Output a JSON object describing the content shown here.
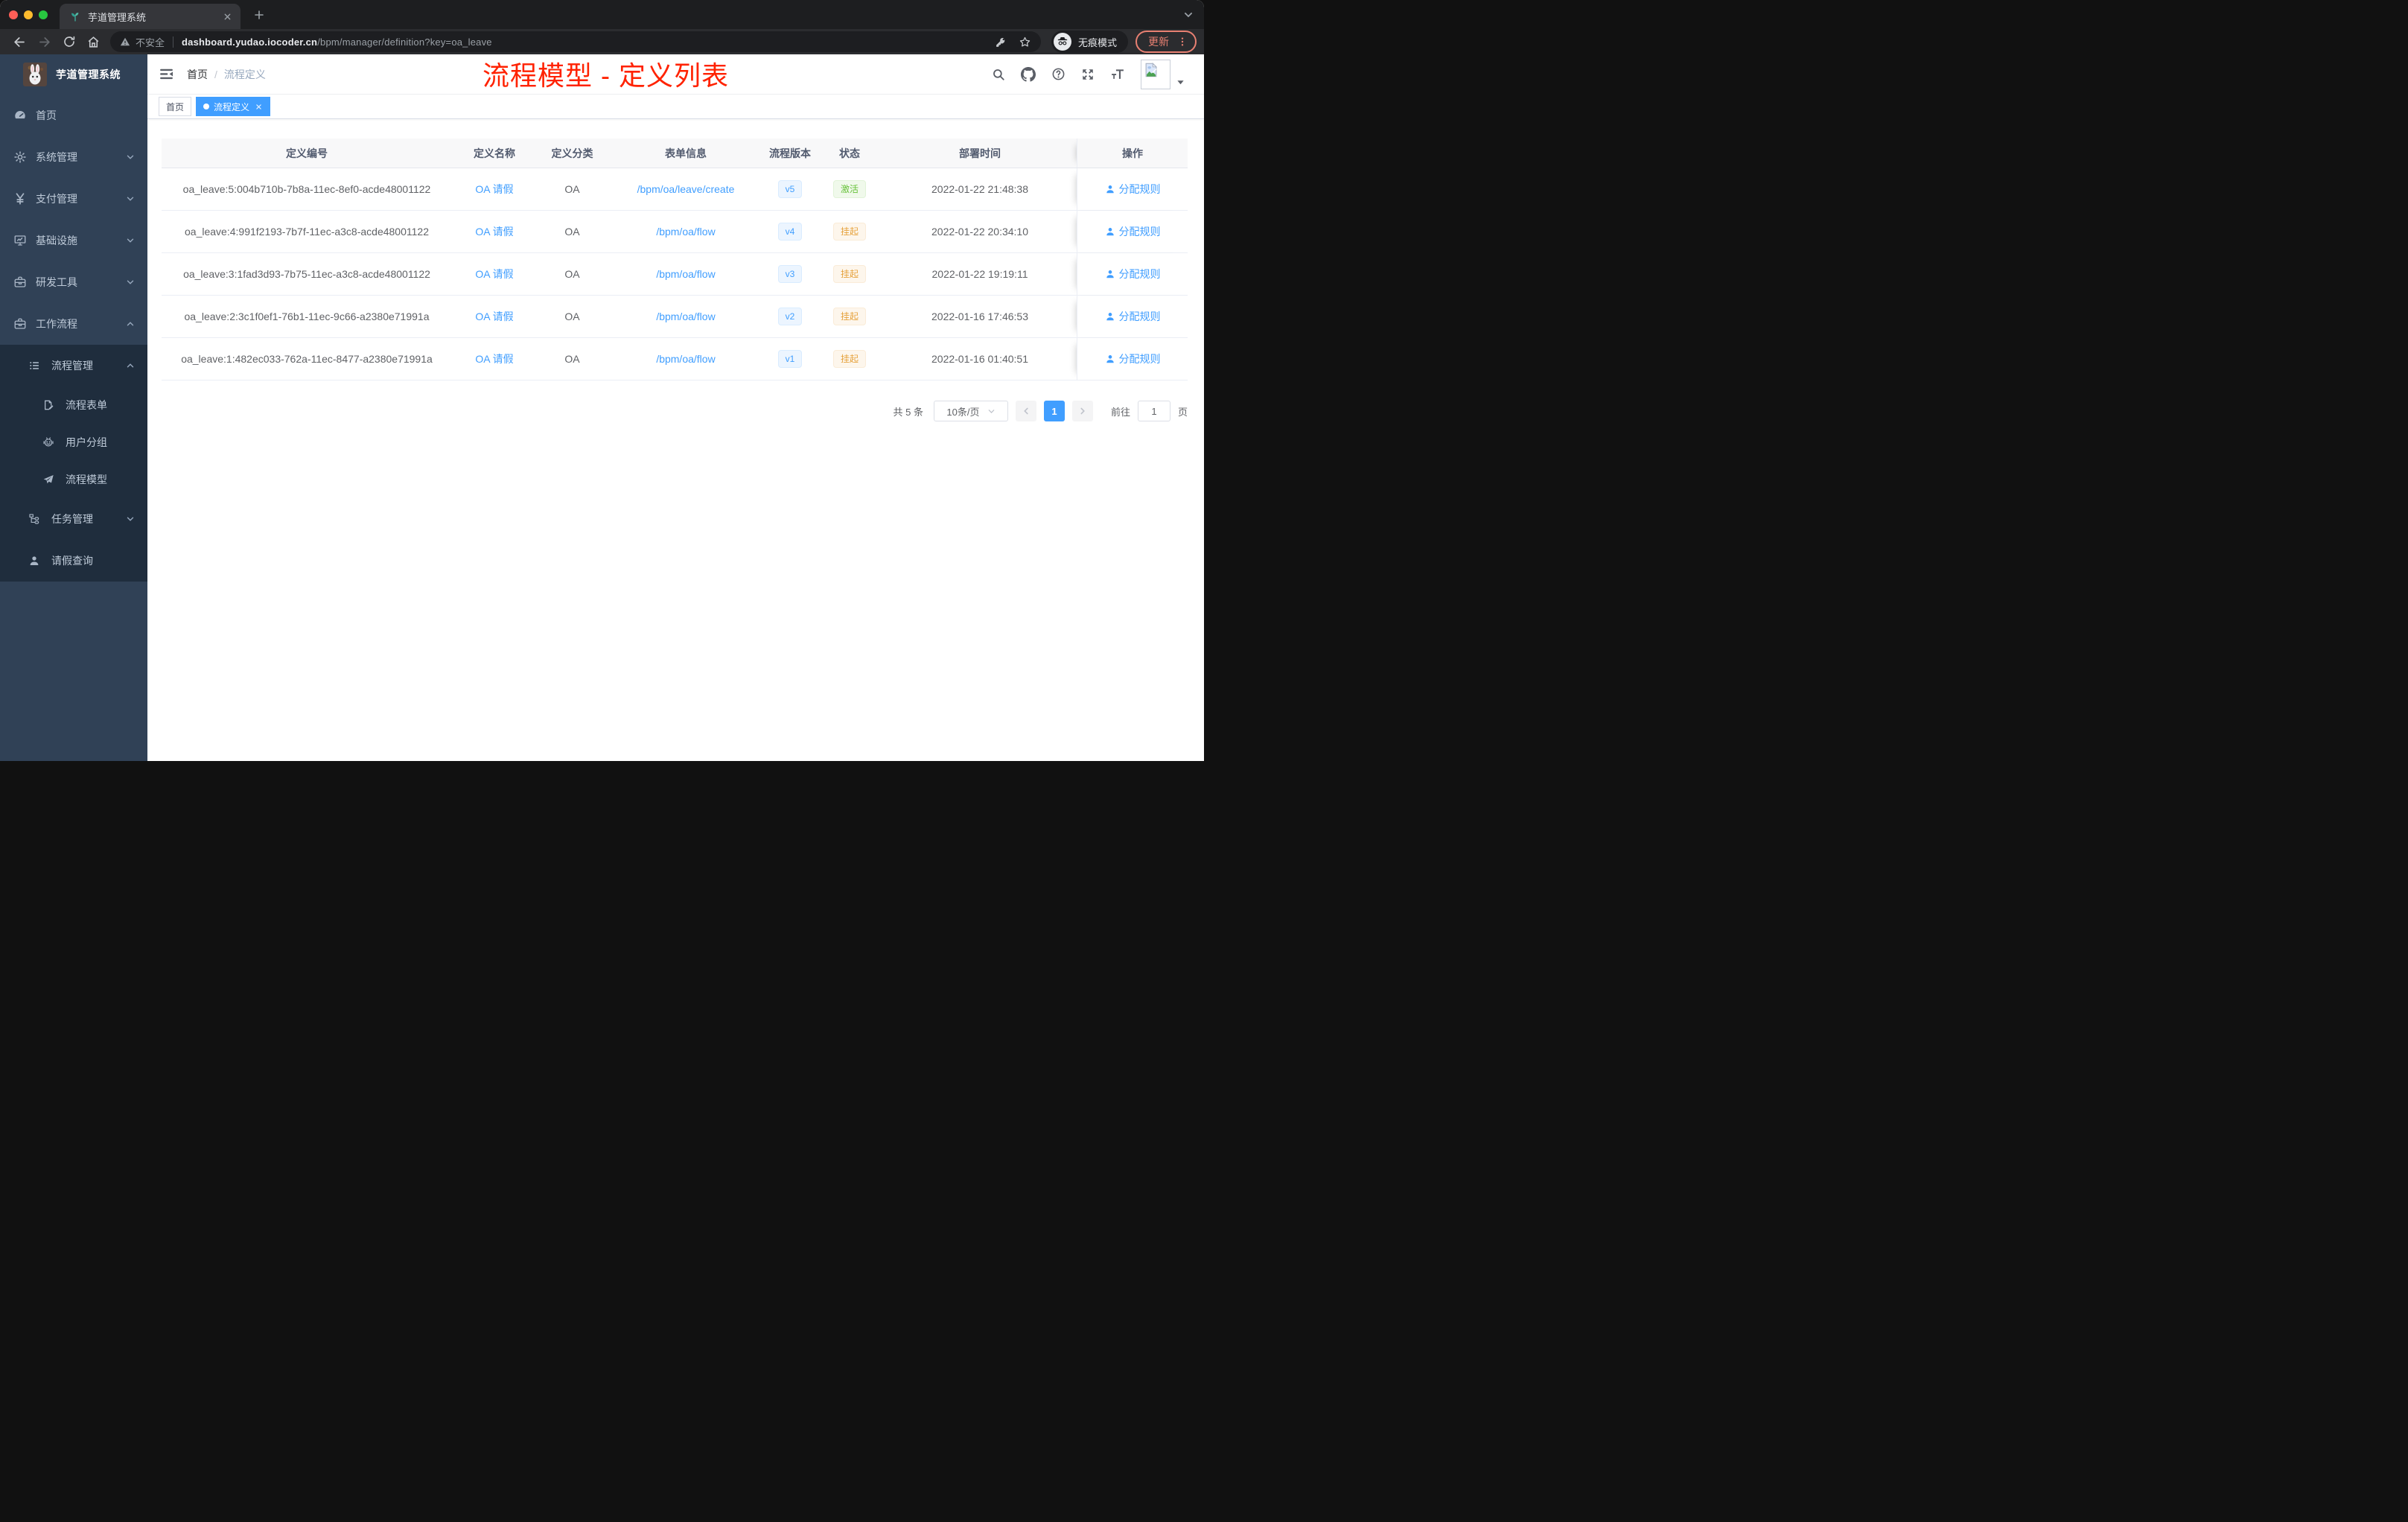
{
  "browser": {
    "tab_title": "芋道管理系统",
    "security_label": "不安全",
    "url_domain": "dashboard.yudao.iocoder.cn",
    "url_path": "/bpm/manager/definition?key=oa_leave",
    "incognito_label": "无痕模式",
    "update_label": "更新"
  },
  "sidebar": {
    "app_title": "芋道管理系统",
    "items": [
      {
        "key": "home",
        "label": "首页",
        "icon": "dashboard-icon",
        "level": 1,
        "arrow": null,
        "dark": false
      },
      {
        "key": "system",
        "label": "系统管理",
        "icon": "gear-icon",
        "level": 1,
        "arrow": "down",
        "dark": false
      },
      {
        "key": "payment",
        "label": "支付管理",
        "icon": "yen-icon",
        "level": 1,
        "arrow": "down",
        "dark": false
      },
      {
        "key": "infrastructure",
        "label": "基础设施",
        "icon": "monitor-icon",
        "level": 1,
        "arrow": "down",
        "dark": false
      },
      {
        "key": "dev-tools",
        "label": "研发工具",
        "icon": "briefcase-icon",
        "level": 1,
        "arrow": "down",
        "dark": false
      },
      {
        "key": "workflow",
        "label": "工作流程",
        "icon": "briefcase-icon",
        "level": 1,
        "arrow": "up",
        "dark": false
      },
      {
        "key": "process-management",
        "label": "流程管理",
        "icon": "list-icon",
        "level": 2,
        "arrow": "up",
        "dark": true
      },
      {
        "key": "process-form",
        "label": "流程表单",
        "icon": "form-icon",
        "level": 3,
        "arrow": null,
        "dark": true
      },
      {
        "key": "user-group",
        "label": "用户分组",
        "icon": "robot-icon",
        "level": 3,
        "arrow": null,
        "dark": true
      },
      {
        "key": "process-model",
        "label": "流程模型",
        "icon": "paper-plane-icon",
        "level": 3,
        "arrow": null,
        "dark": true
      },
      {
        "key": "task-management",
        "label": "任务管理",
        "icon": "tree-icon",
        "level": 2,
        "arrow": "down",
        "dark": true
      },
      {
        "key": "leave-query",
        "label": "请假查询",
        "icon": "person-icon",
        "level": 2,
        "arrow": null,
        "dark": true
      }
    ]
  },
  "navbar": {
    "breadcrumb": {
      "home": "首页",
      "separator": "/",
      "current": "流程定义"
    }
  },
  "tags": {
    "home": "首页",
    "active": "流程定义"
  },
  "annotation": {
    "text": "流程模型 - 定义列表",
    "color": "#ff2200"
  },
  "table": {
    "columns": [
      "定义编号",
      "定义名称",
      "定义分类",
      "表单信息",
      "流程版本",
      "状态",
      "部署时间",
      "操作"
    ],
    "rows": [
      {
        "id": "oa_leave:5:004b710b-7b8a-11ec-8ef0-acde48001122",
        "name": "OA 请假",
        "category": "OA",
        "form": "/bpm/oa/leave/create",
        "version": "v5",
        "status": "激活",
        "status_type": "success",
        "time": "2022-01-22 21:48:38",
        "action": "分配规则"
      },
      {
        "id": "oa_leave:4:991f2193-7b7f-11ec-a3c8-acde48001122",
        "name": "OA 请假",
        "category": "OA",
        "form": "/bpm/oa/flow",
        "version": "v4",
        "status": "挂起",
        "status_type": "warning",
        "time": "2022-01-22 20:34:10",
        "action": "分配规则"
      },
      {
        "id": "oa_leave:3:1fad3d93-7b75-11ec-a3c8-acde48001122",
        "name": "OA 请假",
        "category": "OA",
        "form": "/bpm/oa/flow",
        "version": "v3",
        "status": "挂起",
        "status_type": "warning",
        "time": "2022-01-22 19:19:11",
        "action": "分配规则"
      },
      {
        "id": "oa_leave:2:3c1f0ef1-76b1-11ec-9c66-a2380e71991a",
        "name": "OA 请假",
        "category": "OA",
        "form": "/bpm/oa/flow",
        "version": "v2",
        "status": "挂起",
        "status_type": "warning",
        "time": "2022-01-16 17:46:53",
        "action": "分配规则"
      },
      {
        "id": "oa_leave:1:482ec033-762a-11ec-8477-a2380e71991a",
        "name": "OA 请假",
        "category": "OA",
        "form": "/bpm/oa/flow",
        "version": "v1",
        "status": "挂起",
        "status_type": "warning",
        "time": "2022-01-16 01:40:51",
        "action": "分配规则"
      }
    ]
  },
  "pagination": {
    "total": "共 5 条",
    "page_size": "10条/页",
    "current_page": "1",
    "goto": "前往",
    "goto_value": "1",
    "unit": "页"
  },
  "colors": {
    "accent": "#409eff",
    "sidebar_bg": "#304156",
    "sidebar_submenu_bg": "#1f2d3d",
    "status_active": "#67c23a",
    "status_suspended": "#e6a23c",
    "annotation_red": "#ff2200",
    "update_button": "#e88072"
  }
}
